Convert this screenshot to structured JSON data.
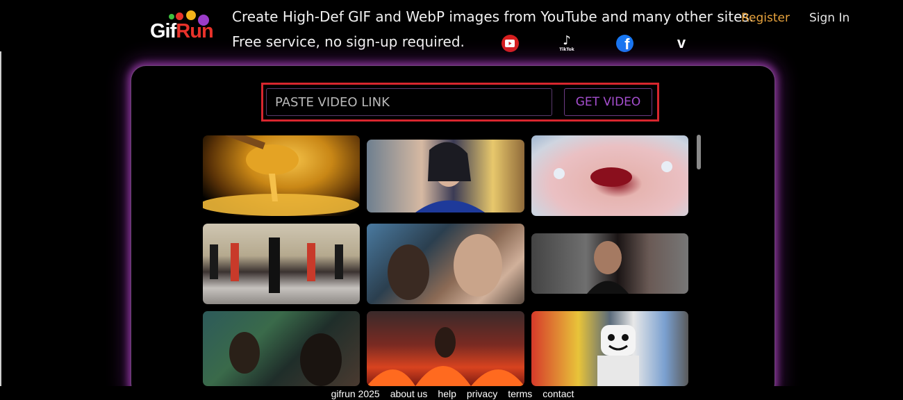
{
  "header": {
    "logo": {
      "part1": "Gif",
      "part2": "Run"
    },
    "tagline": "Create High-Def GIF and WebP images from YouTube and many other sites.",
    "subline": "Free service, no sign-up required.",
    "register_label": "Register",
    "signin_label": "Sign In",
    "social": [
      {
        "name": "youtube",
        "icon": "youtube-icon"
      },
      {
        "name": "tiktok",
        "icon": "tiktok-icon",
        "label": "TikTok"
      },
      {
        "name": "facebook",
        "icon": "facebook-icon",
        "glyph": "f"
      },
      {
        "name": "vimeo",
        "icon": "vimeo-icon",
        "glyph": "v"
      }
    ]
  },
  "search": {
    "placeholder": "PASTE VIDEO LINK",
    "button_label": "GET VIDEO"
  },
  "colors": {
    "accent_purple": "#a64fd0",
    "highlight_red": "#d8262e",
    "register_orange": "#e8a33d",
    "panel_glow": "#c850dc"
  },
  "gallery": [
    {
      "id": "t1"
    },
    {
      "id": "t2"
    },
    {
      "id": "t3"
    },
    {
      "id": "t4"
    },
    {
      "id": "t5"
    },
    {
      "id": "t6"
    },
    {
      "id": "t7"
    },
    {
      "id": "t8"
    },
    {
      "id": "t9"
    }
  ],
  "footer": {
    "brand": "gifrun 2025",
    "links": [
      "about us",
      "help",
      "privacy",
      "terms",
      "contact"
    ]
  }
}
